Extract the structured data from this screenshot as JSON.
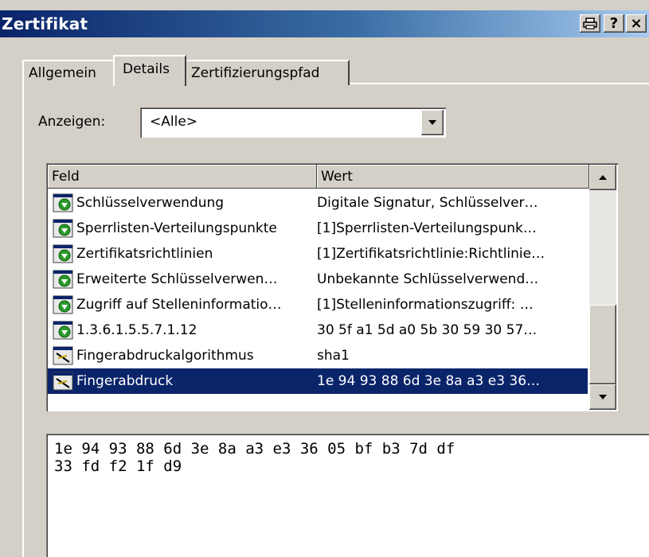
{
  "window": {
    "title": "Zertifikat"
  },
  "titlebar": {
    "help_label": "?",
    "close_label": "×"
  },
  "tabs": [
    {
      "label": "Allgemein",
      "active": false
    },
    {
      "label": "Details",
      "active": true
    },
    {
      "label": "Zertifizierungspfad",
      "active": false
    }
  ],
  "show": {
    "label": "Anzeigen:",
    "selected": "<Alle>"
  },
  "list": {
    "columns": [
      "Feld",
      "Wert"
    ],
    "rows": [
      {
        "field": "Schlüsselverwendung",
        "value": "Digitale Signatur, Schlüsselver…",
        "icon": "extension-icon"
      },
      {
        "field": "Sperrlisten-Verteilungspunkte",
        "value": "[1]Sperrlisten-Verteilungspunk…",
        "icon": "extension-icon"
      },
      {
        "field": "Zertifikatsrichtlinien",
        "value": "[1]Zertifikatsrichtlinie:Richtlinie…",
        "icon": "extension-icon"
      },
      {
        "field": "Erweiterte Schlüsselverwen…",
        "value": "Unbekannte Schlüsselverwend…",
        "icon": "extension-icon"
      },
      {
        "field": "Zugriff auf Stelleninformatio…",
        "value": "[1]Stelleninformationszugriff: …",
        "icon": "extension-icon"
      },
      {
        "field": "1.3.6.1.5.5.7.1.12",
        "value": "30 5f a1 5d a0 5b 30 59 30 57…",
        "icon": "extension-icon"
      },
      {
        "field": "Fingerabdruckalgorithmus",
        "value": "sha1",
        "icon": "property-icon"
      },
      {
        "field": "Fingerabdruck",
        "value": "1e 94 93 88 6d 3e 8a a3 e3 36…",
        "icon": "property-icon",
        "selected": true
      }
    ]
  },
  "detail": {
    "line1": "1e 94 93 88 6d 3e 8a a3 e3 36 05 bf b3 7d df",
    "line2": "33 fd f2 1f d9"
  }
}
